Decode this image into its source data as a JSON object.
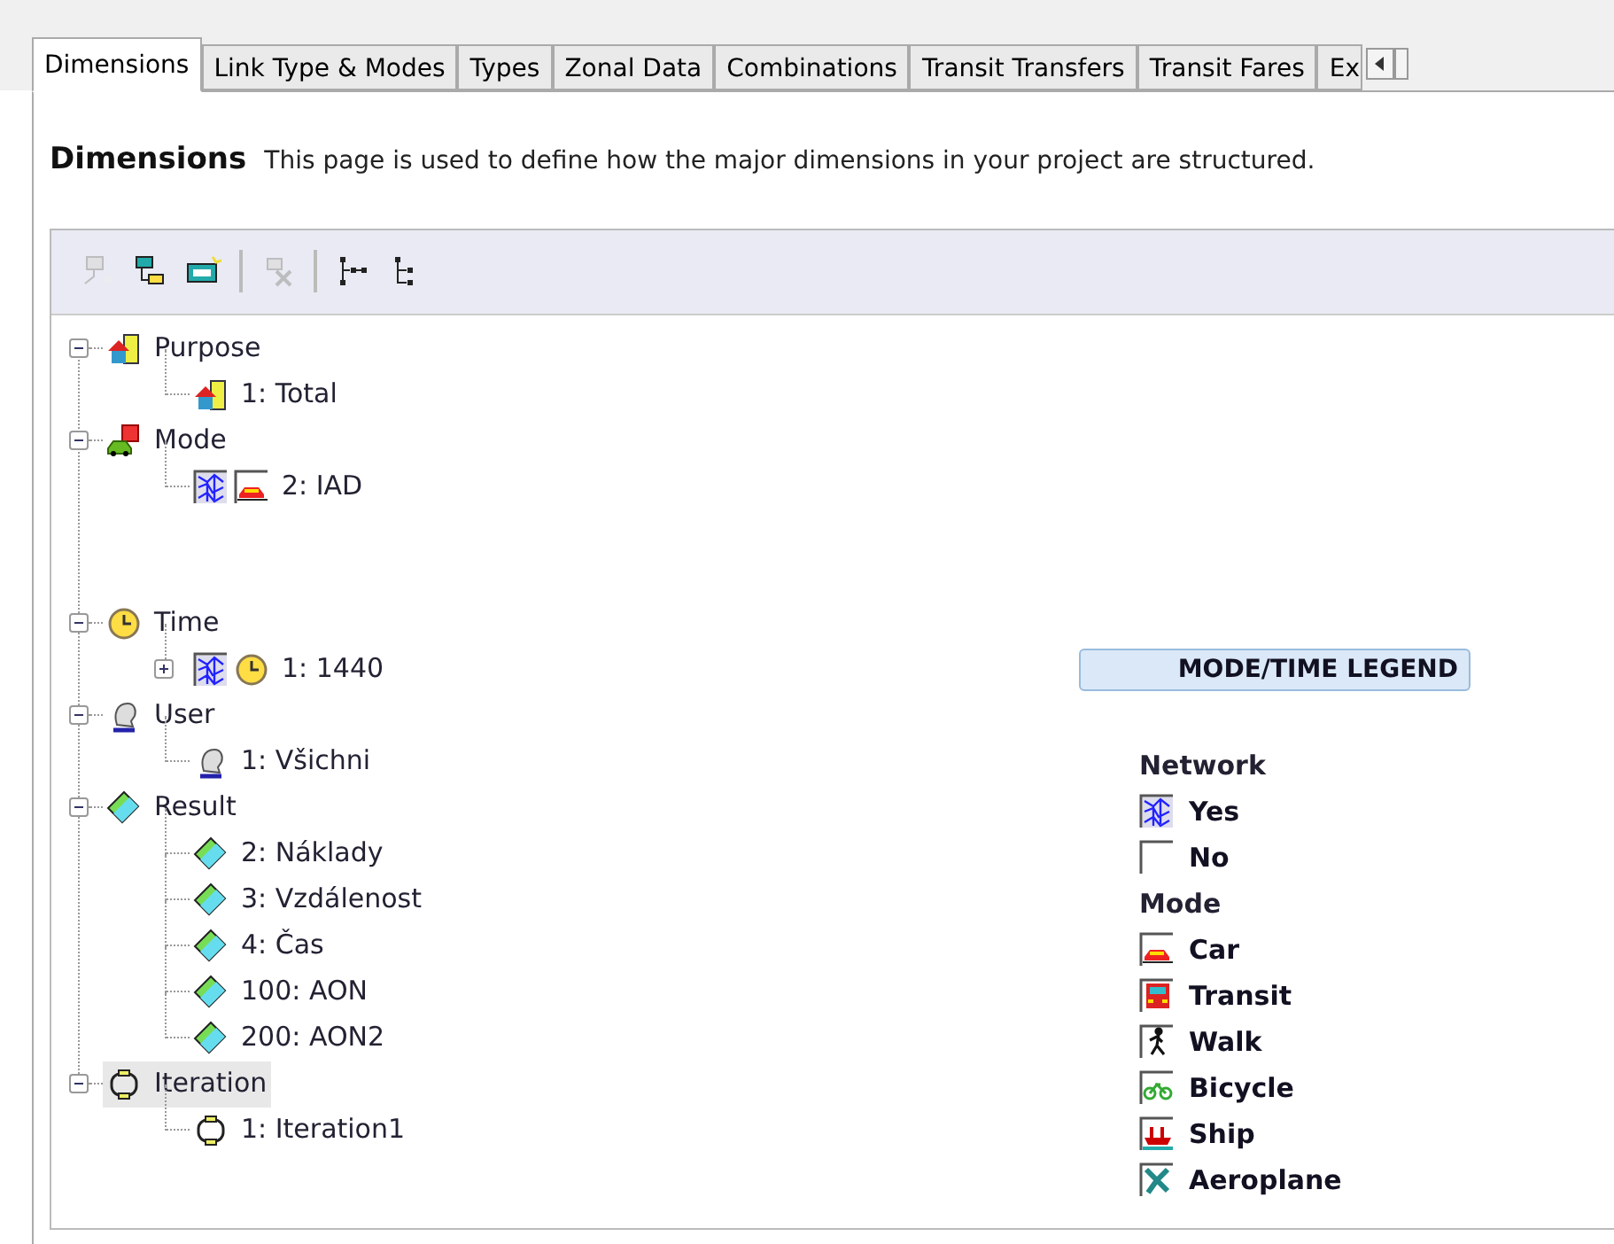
{
  "tabs": [
    {
      "label": "Dimensions",
      "selected": true
    },
    {
      "label": "Link Type & Modes",
      "selected": false
    },
    {
      "label": "Types",
      "selected": false
    },
    {
      "label": "Zonal Data",
      "selected": false
    },
    {
      "label": "Combinations",
      "selected": false
    },
    {
      "label": "Transit Transfers",
      "selected": false
    },
    {
      "label": "Transit Fares",
      "selected": false
    },
    {
      "label": "Ex",
      "selected": false
    }
  ],
  "header": {
    "title": "Dimensions",
    "description": "This page is used to define how the major dimensions in your project are structured."
  },
  "toolbar": [
    [
      {
        "kind": "add-node",
        "disabled": true
      },
      {
        "kind": "add-child",
        "disabled": false
      },
      {
        "kind": "add-number",
        "disabled": false
      }
    ],
    [
      {
        "kind": "delete",
        "disabled": true
      }
    ],
    [
      {
        "kind": "expand-tree",
        "disabled": false
      },
      {
        "kind": "collapse-tree",
        "disabled": false
      }
    ]
  ],
  "tree": [
    {
      "label": "Purpose",
      "icons": [
        {
          "kind": "purpose"
        }
      ],
      "expanded": true,
      "selected": false,
      "children": [
        {
          "label": "1: Total",
          "icons": [
            {
              "kind": "purpose"
            }
          ],
          "selected": false
        }
      ]
    },
    {
      "label": "Mode",
      "icons": [
        {
          "kind": "mode"
        }
      ],
      "expanded": true,
      "selected": false,
      "children": [
        {
          "label": "2: IAD",
          "icons": [
            {
              "kind": "network"
            },
            {
              "kind": "car"
            }
          ],
          "selected": false
        }
      ]
    },
    {
      "label": "Time",
      "icons": [
        {
          "kind": "clock"
        }
      ],
      "expanded": true,
      "selected": false,
      "children": [
        {
          "label": "1: 1440",
          "icons": [
            {
              "kind": "network"
            },
            {
              "kind": "clock"
            }
          ],
          "selected": false,
          "expanded": false
        }
      ]
    },
    {
      "label": "User",
      "icons": [
        {
          "kind": "user"
        }
      ],
      "expanded": true,
      "selected": false,
      "children": [
        {
          "label": "1: Všichni",
          "icons": [
            {
              "kind": "user"
            }
          ],
          "selected": false
        }
      ]
    },
    {
      "label": "Result",
      "icons": [
        {
          "kind": "result"
        }
      ],
      "expanded": true,
      "selected": false,
      "children": [
        {
          "label": "2: Náklady",
          "icons": [
            {
              "kind": "result"
            }
          ],
          "selected": false
        },
        {
          "label": "3: Vzdálenost",
          "icons": [
            {
              "kind": "result"
            }
          ],
          "selected": false
        },
        {
          "label": "4: Čas",
          "icons": [
            {
              "kind": "result"
            }
          ],
          "selected": false
        },
        {
          "label": "100: AON",
          "icons": [
            {
              "kind": "result"
            }
          ],
          "selected": false
        },
        {
          "label": "200: AON2",
          "icons": [
            {
              "kind": "result"
            }
          ],
          "selected": false
        }
      ]
    },
    {
      "label": "Iteration",
      "icons": [
        {
          "kind": "iteration"
        }
      ],
      "expanded": true,
      "selected": true,
      "children": [
        {
          "label": "1: Iteration1",
          "icons": [
            {
              "kind": "iteration"
            }
          ],
          "selected": false
        }
      ]
    }
  ],
  "legend": {
    "button": "MODE/TIME LEGEND",
    "sections": [
      {
        "heading": "Network",
        "items": [
          {
            "label": "Yes",
            "kind": "network"
          },
          {
            "label": "No",
            "kind": "none"
          }
        ]
      },
      {
        "heading": "Mode",
        "items": [
          {
            "label": "Car",
            "kind": "car"
          },
          {
            "label": "Transit",
            "kind": "transit"
          },
          {
            "label": "Walk",
            "kind": "walk"
          },
          {
            "label": "Bicycle",
            "kind": "bicycle"
          },
          {
            "label": "Ship",
            "kind": "ship"
          },
          {
            "label": "Aeroplane",
            "kind": "aeroplane"
          }
        ]
      }
    ]
  }
}
